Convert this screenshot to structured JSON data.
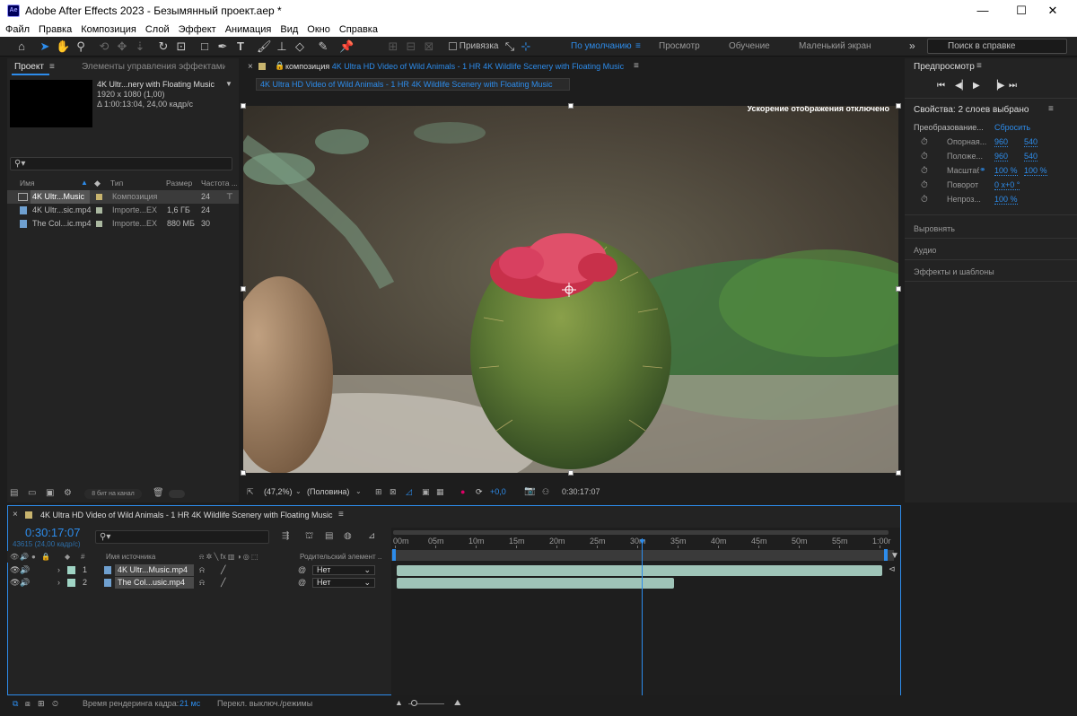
{
  "window": {
    "title": "Adobe After Effects 2023 - Безымянный проект.aep *",
    "app_icon": "Ae",
    "minimize": "—",
    "maximize": "☐",
    "close": "✕"
  },
  "menu": [
    "Файл",
    "Правка",
    "Композиция",
    "Слой",
    "Эффект",
    "Анимация",
    "Вид",
    "Окно",
    "Справка"
  ],
  "toolbar": {
    "snapping_label": "Привязка",
    "workspaces": [
      "По умолчанию",
      "Просмотр",
      "Обучение",
      "Маленький экран"
    ],
    "active_workspace": "По умолчанию",
    "more": "»",
    "help_search_placeholder": "Поиск в справке"
  },
  "project_panel": {
    "tab_project": "Проект",
    "tab_effects": "Элементы управления эффектами",
    "selected_name": "4K Ultr...nery with Floating Music",
    "selected_resolution": "1920 x 1080 (1,00)",
    "selected_duration": "Δ 1:00:13:04, 24,00 кадр/с",
    "search_placeholder": "",
    "columns": {
      "name": "Имя",
      "type": "Тип",
      "size": "Размер",
      "fps": "Частота ..."
    },
    "items": [
      {
        "name": "4K Ultr...Music",
        "type": "Композиция",
        "size": "",
        "fps": "24",
        "color": "#c8b46e",
        "selected": true
      },
      {
        "name": "4K Ultr...sic.mp4",
        "type": "Importe...EX",
        "size": "1,6 ГБ",
        "fps": "24",
        "color": "#aab8a0",
        "selected": false
      },
      {
        "name": "The Col...ic.mp4",
        "type": "Importe...EX",
        "size": "880 МБ",
        "fps": "30",
        "color": "#aab8a0",
        "selected": false
      }
    ],
    "bit_depth": "8 бит на канал"
  },
  "composition": {
    "tab_prefix": "композиция",
    "tab_name": "4K Ultra HD Video of Wild Animals - 1 HR 4K Wildlife Scenery with Floating Music",
    "sub_tab": "4K Ultra HD Video of Wild Animals - 1 HR 4K Wildlife Scenery with Floating Music",
    "acceleration_notice": "Ускорение отображения отключено",
    "zoom": "(47,2%)",
    "resolution": "(Половина)",
    "exposure": "+0,0",
    "timecode": "0:30:17:07"
  },
  "right_panel": {
    "preview_title": "Предпросмотр",
    "properties_title": "Свойства: 2 слоев выбрано",
    "transform_label": "Преобразование...",
    "reset_label": "Сбросить",
    "props": [
      {
        "name": "Опорная...",
        "v1": "960",
        "v2": "540"
      },
      {
        "name": "Положе...",
        "v1": "960",
        "v2": "540"
      },
      {
        "name": "Масштаб",
        "v1": "100 %",
        "v2": "100 %"
      },
      {
        "name": "Поворот",
        "v1": "0 x+0 °",
        "v2": ""
      },
      {
        "name": "Непроз...",
        "v1": "100 %",
        "v2": ""
      }
    ],
    "sections": [
      "Выровнять",
      "Аудио",
      "Эффекты и шаблоны"
    ]
  },
  "timeline": {
    "tab_name": "4K Ultra HD Video of Wild Animals - 1 HR 4K Wildlife Scenery with Floating Music",
    "timecode": "0:30:17:07",
    "frame_info": "43615 (24,00 кадр/с)",
    "columns": {
      "source": "Имя источника",
      "parent": "Родительский элемент ..."
    },
    "ruler": [
      "00m",
      "05m",
      "10m",
      "15m",
      "20m",
      "25m",
      "30m",
      "35m",
      "40m",
      "45m",
      "50m",
      "55m",
      "1:00r"
    ],
    "playhead_fraction": 0.504,
    "layers": [
      {
        "num": "1",
        "name": "4K Ultr...Music.mp4",
        "parent": "Нет",
        "color": "#9fd4c4",
        "end_fraction": 1.0
      },
      {
        "num": "2",
        "name": "The Col...usic.mp4",
        "parent": "Нет",
        "color": "#9fd4c4",
        "end_fraction": 0.572
      }
    ]
  },
  "status": {
    "render_label": "Время рендеринга кадра:",
    "render_value": "21 мс",
    "toggle_label": "Перекл. выключ./режимы"
  }
}
